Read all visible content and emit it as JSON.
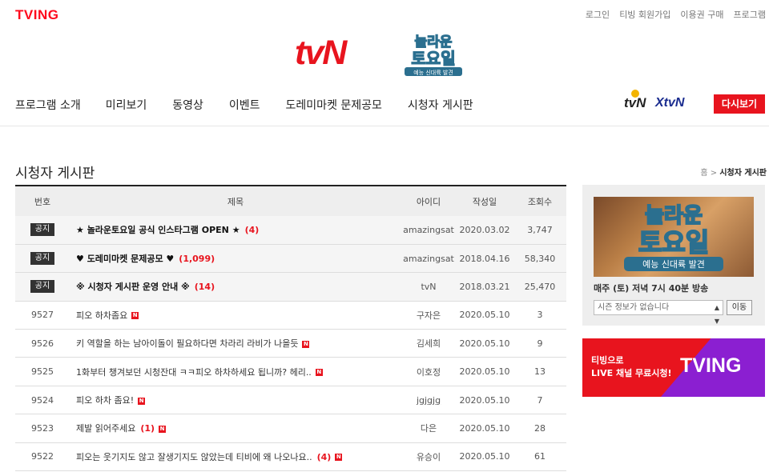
{
  "header": {
    "site_logo": "TVING",
    "util_links": [
      "로그인",
      "티빙 회원가입",
      "이용권 구매",
      "프로그램"
    ],
    "channel_logo": "tvN",
    "show_logo_lines": [
      "놀라운",
      "토요일",
      "예능 신대륙 발견"
    ]
  },
  "nav": {
    "items": [
      "프로그램 소개",
      "미리보기",
      "동영상",
      "이벤트",
      "도레미마켓 문제공모",
      "시청자 게시판"
    ],
    "channels": [
      "tvN",
      "XtvN"
    ],
    "replay_label": "다시보기"
  },
  "board": {
    "title": "시청자 게시판",
    "breadcrumb_home": "홈",
    "breadcrumb_sep": ">",
    "breadcrumb_current": "시청자 게시판",
    "columns": [
      "번호",
      "제목",
      "아이디",
      "작성일",
      "조회수"
    ],
    "notice_label": "공지",
    "new_icon": "N",
    "rows": [
      {
        "no": "",
        "notice": true,
        "title": "★ 놀라운토요일 공식 인스타그램 OPEN ★",
        "count": "(4)",
        "new": false,
        "id": "amazingsat",
        "date": "2020.03.02",
        "views": "3,747"
      },
      {
        "no": "",
        "notice": true,
        "title": "♥ 도레미마켓 문제공모 ♥",
        "count": "(1,099)",
        "new": false,
        "id": "amazingsat",
        "date": "2018.04.16",
        "views": "58,340"
      },
      {
        "no": "",
        "notice": true,
        "title": "※ 시청자 게시판 운영 안내 ※",
        "count": "(14)",
        "new": false,
        "id": "tvN",
        "date": "2018.03.21",
        "views": "25,470"
      },
      {
        "no": "9527",
        "notice": false,
        "title": "피오 하차좀요",
        "count": "",
        "new": true,
        "id": "구자은",
        "date": "2020.05.10",
        "views": "3"
      },
      {
        "no": "9526",
        "notice": false,
        "title": "키 역할을 하는 남아이돌이 필요하다면 차라리 라비가 나을듯",
        "count": "",
        "new": true,
        "id": "김세희",
        "date": "2020.05.10",
        "views": "9"
      },
      {
        "no": "9525",
        "notice": false,
        "title": "1화부터 챙겨보던 시청잔대 ㅋㅋ피오 하차하세요 됩니까? 헤리..",
        "count": "",
        "new": true,
        "id": "이호정",
        "date": "2020.05.10",
        "views": "13"
      },
      {
        "no": "9524",
        "notice": false,
        "title": "피오 하차 좀요!",
        "count": "",
        "new": true,
        "id": "jgjgjg",
        "date": "2020.05.10",
        "views": "7"
      },
      {
        "no": "9523",
        "notice": false,
        "title": "제발 읽어주세요",
        "count": "(1)",
        "new": true,
        "id": "다은",
        "date": "2020.05.10",
        "views": "28"
      },
      {
        "no": "9522",
        "notice": false,
        "title": "피오는 웃기지도 않고 잘생기지도 않았는데 티비에 왜 나오나요..",
        "count": "(4)",
        "new": true,
        "id": "유승이",
        "date": "2020.05.10",
        "views": "61"
      }
    ]
  },
  "side": {
    "poster_lines": [
      "놀라운",
      "토요일",
      "예능 신대륙 발견"
    ],
    "airtime": "매주 (토) 저녁 7시 40분 방송",
    "season_placeholder": "시즌 정보가 없습니다",
    "move_label": "이동"
  },
  "banner": {
    "line1": "티빙으로",
    "line2": "LIVE 채널 무료시청!",
    "logo": "TVING",
    "colors": {
      "red": "#e8141e",
      "purple": "#8b1fd1"
    }
  }
}
